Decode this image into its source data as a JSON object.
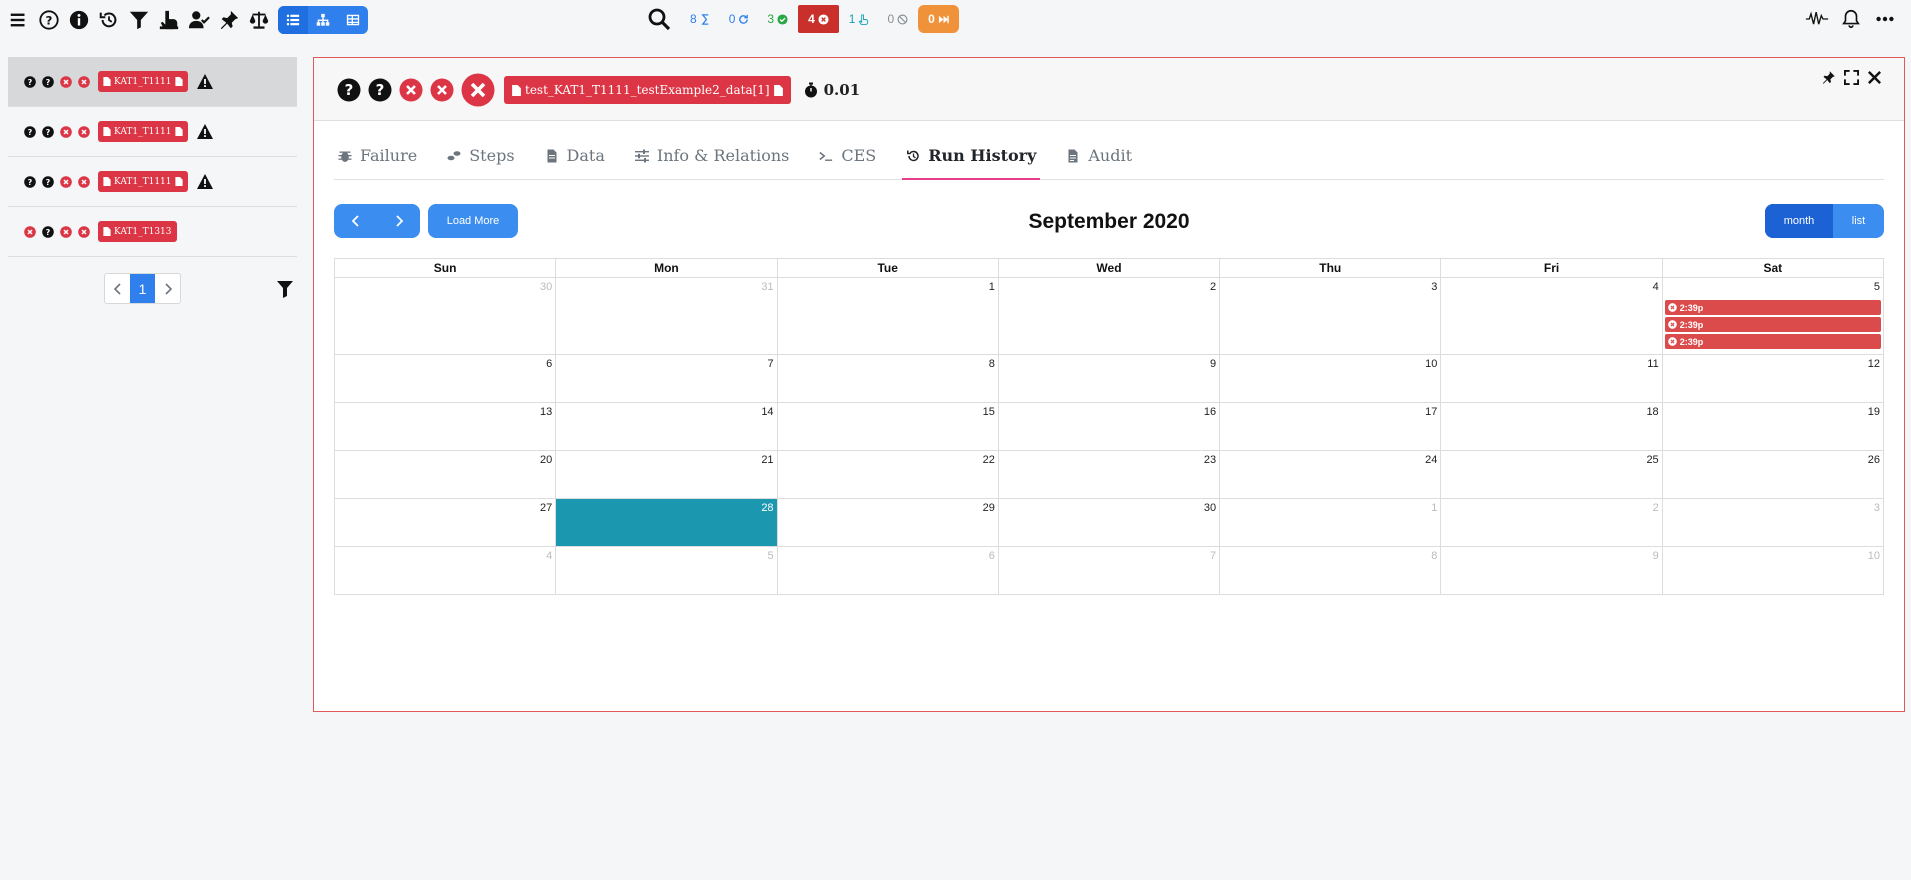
{
  "toolbar": {
    "icons": [
      "menu-icon",
      "help-icon",
      "info-icon",
      "history-icon",
      "filter-icon",
      "hand-point-icon",
      "user-check-icon",
      "pin-icon",
      "balance-scale-icon"
    ],
    "view_modes": [
      "list-view-icon",
      "tree-view-icon",
      "grid-view-icon"
    ]
  },
  "counters": [
    {
      "value": "8",
      "icon": "sum-icon"
    },
    {
      "value": "0",
      "icon": "redo-icon"
    },
    {
      "value": "3",
      "icon": "check-circle-icon"
    },
    {
      "value": "4",
      "icon": "times-circle-icon"
    },
    {
      "value": "1",
      "icon": "hand-point-icon"
    },
    {
      "value": "0",
      "icon": "ban-icon"
    },
    {
      "value": "0",
      "icon": "fast-forward-icon"
    }
  ],
  "right_icons": [
    "wave-icon",
    "bell-icon",
    "ellipsis-icon"
  ],
  "left_list": {
    "items": [
      {
        "label": "KAT1_T1111",
        "warning": true,
        "selected": true
      },
      {
        "label": "KAT1_T1111",
        "warning": true,
        "selected": false
      },
      {
        "label": "KAT1_T1111",
        "warning": true,
        "selected": false
      },
      {
        "label": "KAT1_T1313",
        "warning": false,
        "selected": false
      }
    ],
    "pagination": {
      "current": "1"
    }
  },
  "panel": {
    "test_name": "test_KAT1_T1111_testExample2_data[1]",
    "duration": "0.01",
    "tabs": [
      {
        "label": "Failure",
        "icon": "bug-icon"
      },
      {
        "label": "Steps",
        "icon": "shoe-prints-icon"
      },
      {
        "label": "Data",
        "icon": "file-icon"
      },
      {
        "label": "Info & Relations",
        "icon": "sliders-icon"
      },
      {
        "label": "CES",
        "icon": "terminal-icon"
      },
      {
        "label": "Run History",
        "icon": "history-icon",
        "active": true
      },
      {
        "label": "Audit",
        "icon": "file-alt-icon"
      }
    ]
  },
  "calendar": {
    "title": "September 2020",
    "load_more": "Load More",
    "view_month": "month",
    "view_list": "list",
    "weekdays": [
      "Sun",
      "Mon",
      "Tue",
      "Wed",
      "Thu",
      "Fri",
      "Sat"
    ],
    "weeks": [
      [
        "30",
        "31",
        "1",
        "2",
        "3",
        "4",
        "5"
      ],
      [
        "6",
        "7",
        "8",
        "9",
        "10",
        "11",
        "12"
      ],
      [
        "13",
        "14",
        "15",
        "16",
        "17",
        "18",
        "19"
      ],
      [
        "20",
        "21",
        "22",
        "23",
        "24",
        "25",
        "26"
      ],
      [
        "27",
        "28",
        "29",
        "30",
        "1",
        "2",
        "3"
      ],
      [
        "4",
        "5",
        "6",
        "7",
        "8",
        "9",
        "10"
      ]
    ],
    "today": "28",
    "events": [
      {
        "day": "5",
        "time": "2:39p"
      },
      {
        "day": "5",
        "time": "2:39p"
      },
      {
        "day": "5",
        "time": "2:39p"
      }
    ]
  },
  "colors": {
    "accent": "#2f80ed",
    "danger": "#dc3545",
    "today": "#1b97b0",
    "tab_underline": "#e83e8c"
  }
}
